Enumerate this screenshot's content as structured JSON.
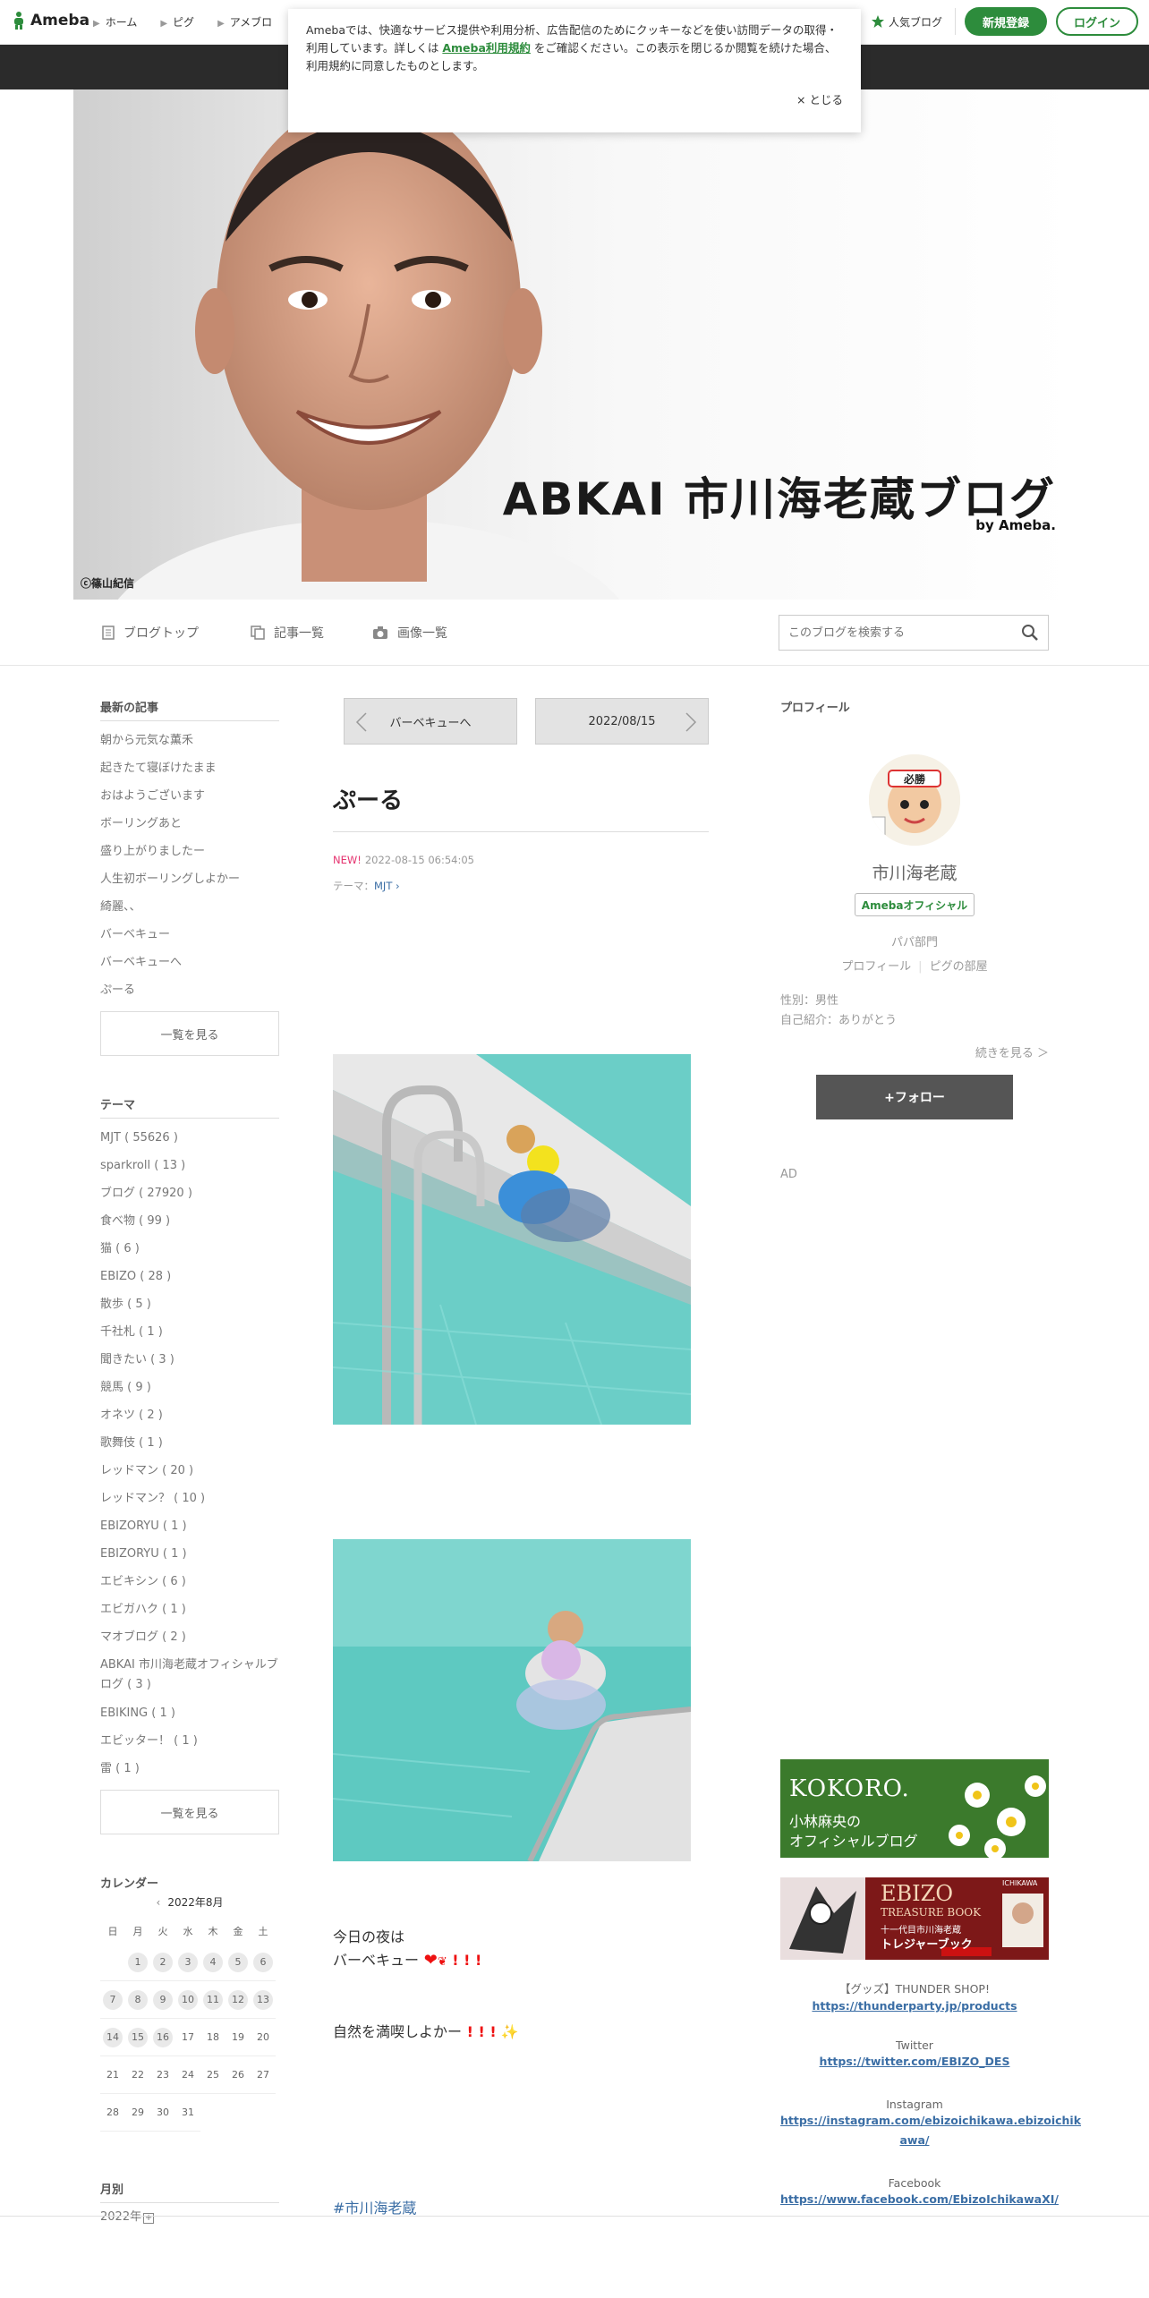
{
  "topbar": {
    "logo": "Ameba",
    "nav": [
      "ホーム",
      "ピグ",
      "アメブロ"
    ],
    "ninki": "人気ブログ",
    "register": "新規登録",
    "login": "ログイン"
  },
  "cookie": {
    "text_before": "Amebaでは、快適なサービス提供や利用分析、広告配信のためにクッキーなどを使い訪問データの取得・利用しています。詳しくは ",
    "link": "Ameba利用規約",
    "text_after": " をご確認ください。この表示を閉じるか閲覧を続けた場合、利用規約に同意したものとします。",
    "close": "× とじる"
  },
  "header": {
    "title": "ABKAI 市川海老蔵ブログ",
    "by": "by Ameba.",
    "copyright": "ⓒ篠山紀信"
  },
  "subnav": {
    "blog_top": "ブログトップ",
    "articles": "記事一覧",
    "images": "画像一覧",
    "search_placeholder": "このブログを検索する"
  },
  "left": {
    "recent_title": "最新の記事",
    "recent": [
      "朝から元気な薫禾",
      "起きたて寝ぼけたまま",
      "おはようございます",
      "ボーリングあと",
      "盛り上がりましたー",
      "人生初ボーリングしよかー",
      "綺麗、、",
      "バーベキュー",
      "バーベキューへ",
      "ぷーる"
    ],
    "more": "一覧を見る",
    "theme_title": "テーマ",
    "themes": [
      "MJT ( 55626 )",
      "sparkroll ( 13 )",
      "ブログ ( 27920 )",
      "食べ物 ( 99 )",
      "猫 ( 6 )",
      "EBIZO ( 28 )",
      "散歩 ( 5 )",
      "千社札 ( 1 )",
      "聞きたい ( 3 )",
      "競馬 ( 9 )",
      "オネツ ( 2 )",
      "歌舞伎 ( 1 )",
      "レッドマン ( 20 )",
      "レッドマン？ ( 10 )",
      "EBIZORYU ( 1 )",
      "EBIZORYU ( 1 )",
      "エビキシン ( 6 )",
      "エビガハク ( 1 )",
      "マオブログ ( 2 )",
      "ABKAI 市川海老蔵オフィシャルブログ ( 3 )",
      "EBIKING ( 1 )",
      "エビッター！ ( 1 )",
      "雷 ( 1 )"
    ],
    "more2": "一覧を見る",
    "calendar_title": "カレンダー",
    "calendar_month": "2022年8月",
    "weekdays": [
      "日",
      "月",
      "火",
      "水",
      "木",
      "金",
      "土"
    ],
    "archive_title": "月別",
    "archive_year": "2022年"
  },
  "main": {
    "prev": "バーベキューへ",
    "next": "2022/08/15",
    "title": "ぷーる",
    "new_badge": "NEW!",
    "datetime": "2022-08-15 06:54:05",
    "theme_label": "テーマ：",
    "theme": "MJT",
    "line1": "今日の夜は",
    "line2": "バーベキュー",
    "line3": "自然を満喫しよかー",
    "hashtag": "#市川海老蔵"
  },
  "right": {
    "profile_title": "プロフィール",
    "name": "市川海老蔵",
    "official": "Amebaオフィシャル",
    "dept": "パパ部門",
    "profile_link": "プロフィール",
    "pig_link": "ピグの部屋",
    "gender": "性別：男性",
    "intro": "自己紹介：ありがとう",
    "more": "続きを見る ＞",
    "follow": "+フォロー",
    "ad": "AD",
    "banner1_line1": "KOKORO.",
    "banner1_line2": "小林麻央の",
    "banner1_line3": "オフィシャルブログ",
    "banner2_line1": "EBIZO",
    "banner2_line2": "TREASURE BOOK",
    "banner2_line3": "十一代目市川海老蔵",
    "banner2_line4": "トレジャーブック",
    "banner2_corner": "ICHIKAWA",
    "goods_label": "【グッズ】THUNDER SHOP!",
    "goods_link": "https://thunderparty.jp/products",
    "twitter_label": "Twitter",
    "twitter_link": "https://twitter.com/EBIZO_DES",
    "instagram_label": "Instagram",
    "instagram_link1": "https://instagram.com/ebizoichikawa.ebizoichik",
    "instagram_link2": "awa/",
    "facebook_label": "Facebook",
    "facebook_link": "https://www.facebook.com/EbizoIchikawaXI/"
  },
  "colors": {
    "brand_green": "#2d8c3c",
    "link_blue": "#3b6ea5",
    "new_pink": "#e5336f",
    "pool_teal": "#5ec9c1"
  }
}
